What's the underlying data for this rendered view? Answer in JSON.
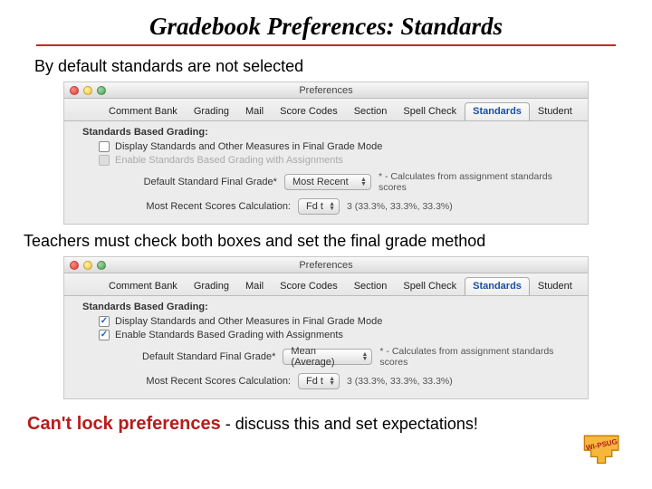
{
  "slide": {
    "title": "Gradebook Preferences:  Standards",
    "caption1": "By default standards are not selected",
    "caption2": "Teachers must check both boxes and set the final grade method",
    "warn_lead": "Can't lock preferences",
    "warn_rest": "- discuss this and set expectations!"
  },
  "window": {
    "title": "Preferences",
    "tabs": [
      "Comment Bank",
      "Grading",
      "Mail",
      "Score Codes",
      "Section",
      "Spell Check",
      "Standards",
      "Student"
    ],
    "active_tab": "Standards"
  },
  "pane": {
    "section": "Standards Based Grading:",
    "opt_display": "Display Standards and Other Measures in Final Grade Mode",
    "opt_enable": "Enable Standards Based Grading with Assignments",
    "label_default": "Default Standard Final Grade*",
    "label_recent": "Most Recent Scores Calculation:",
    "note_calc": "* - Calculates from assignment standards scores",
    "percents": "3 (33.3%, 33.3%, 33.3%)"
  },
  "shot1": {
    "default_value": "Most Recent",
    "recent_value": "Fd t"
  },
  "shot2": {
    "default_value": "Mean (Average)",
    "recent_value": "Fd t"
  },
  "logo": {
    "text": "WI-PSUG"
  }
}
